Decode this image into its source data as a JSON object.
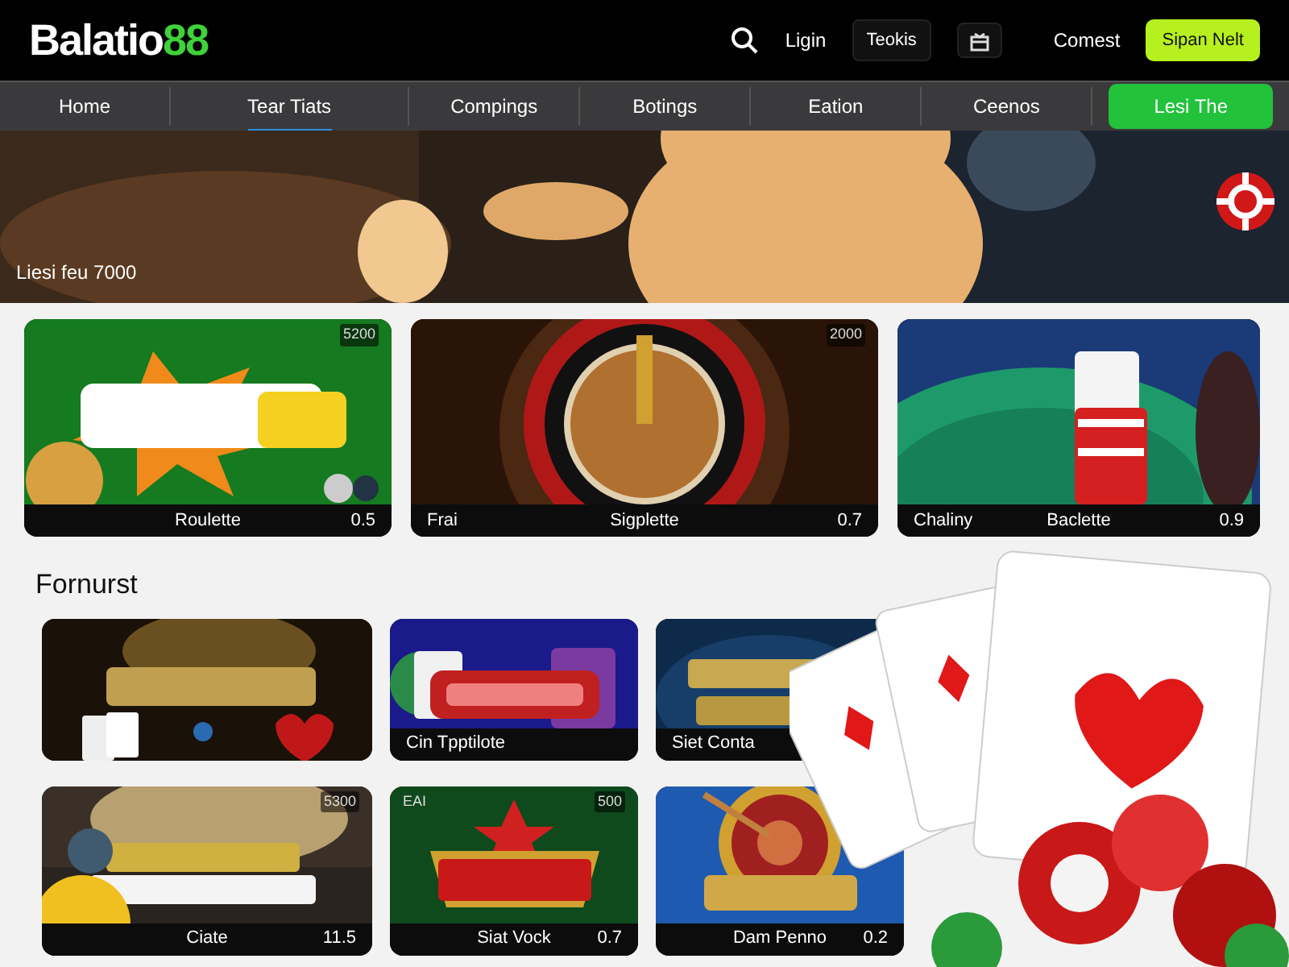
{
  "header": {
    "logo": {
      "text": "Balatio",
      "accent": "88"
    },
    "actions": [
      {
        "kind": "search"
      },
      {
        "kind": "link",
        "label": "Ligin"
      },
      {
        "kind": "outline",
        "label": "Teokis"
      },
      {
        "kind": "icon"
      },
      {
        "kind": "link",
        "label": "Comest"
      },
      {
        "kind": "primary",
        "label": "Sipan Nelt"
      }
    ]
  },
  "nav": {
    "items": [
      {
        "label": "Home",
        "selected": false
      },
      {
        "label": "Tear Tiats",
        "selected": true
      },
      {
        "label": "Compings",
        "selected": false
      },
      {
        "label": "Botings",
        "selected": false
      },
      {
        "label": "Eation",
        "selected": false
      },
      {
        "label": "Ceenos",
        "selected": false
      }
    ],
    "cta": "Lesi The"
  },
  "hero": {
    "kind": "picture",
    "caption": "Liesi feu 7000"
  },
  "featured": [
    {
      "badge": "5200",
      "title": "Roulette",
      "odds": "0.5"
    },
    {
      "badge": "2000",
      "tag": "Frai",
      "title": "Sigplette",
      "odds": "0.7"
    },
    {
      "tag": "Chaliny",
      "title": "Baclette",
      "odds": "0.9"
    }
  ],
  "section": {
    "title": "Fornurst",
    "games": [
      {
        "kind": "picture"
      },
      {
        "title": "Cin Tpptilote"
      },
      {
        "title": "Siet Conta"
      },
      {
        "badge": "5300",
        "title": "Ciate",
        "odds": "11.5"
      },
      {
        "tag": "EAI",
        "badge": "500",
        "title": "Siat Vock",
        "odds": "0.7"
      },
      {
        "title": "Dam Penno",
        "odds": "0.2"
      }
    ]
  }
}
